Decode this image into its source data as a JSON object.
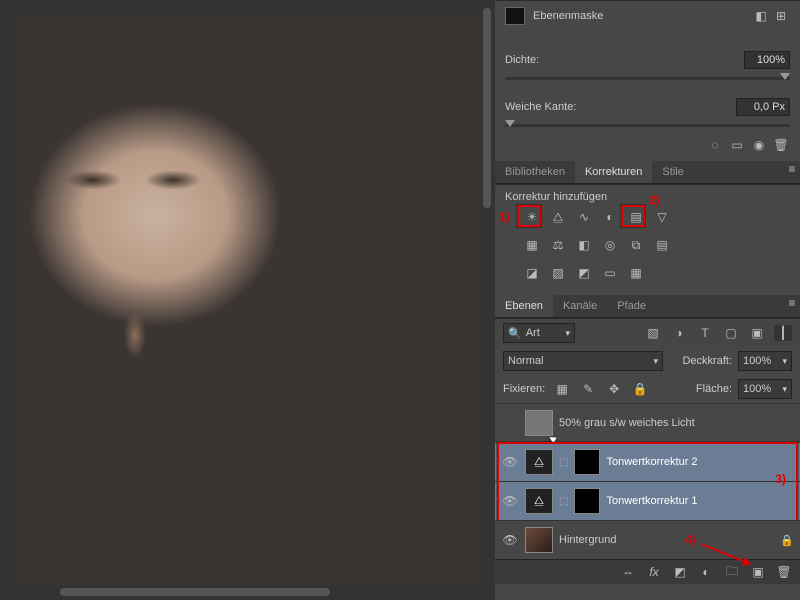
{
  "properties": {
    "mask_label": "Ebenenmaske",
    "density_label": "Dichte:",
    "density_value": "100%",
    "feather_label": "Weiche Kante:",
    "feather_value": "0,0 Px"
  },
  "adj_tabs": {
    "lib": "Bibliotheken",
    "adj": "Korrekturen",
    "styles": "Stile"
  },
  "adjustments": {
    "add_label": "Korrektur hinzufügen",
    "ann1": "1)",
    "ann2": "2)"
  },
  "layers_tabs": {
    "layers": "Ebenen",
    "channels": "Kanäle",
    "paths": "Pfade"
  },
  "layers_panel": {
    "filter_kind": "Art",
    "blend_mode": "Normal",
    "opacity_label": "Deckkraft:",
    "opacity_value": "100%",
    "lock_label": "Fixieren:",
    "fill_label": "Fläche:",
    "fill_value": "100%"
  },
  "layers": [
    {
      "name": "50% grau s/w weiches Licht"
    },
    {
      "name": "Tonwertkorrektur 2"
    },
    {
      "name": "Tonwertkorrektur 1"
    },
    {
      "name": "Hintergrund"
    }
  ],
  "ann3": "3)",
  "ann4": "4)"
}
